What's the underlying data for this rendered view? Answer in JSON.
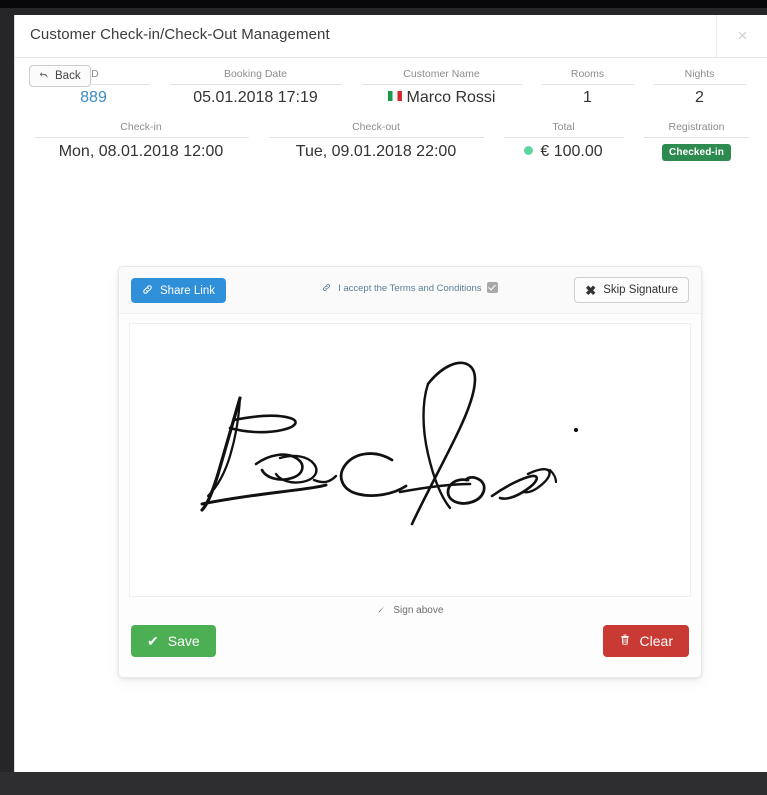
{
  "modal": {
    "title": "Customer Check-in/Check-Out Management",
    "close_label": "×"
  },
  "toolbar": {
    "back_label": "Back"
  },
  "booking": {
    "row1_headers": [
      "ID",
      "Booking Date",
      "Customer Name",
      "Rooms",
      "Nights"
    ],
    "row1_values": {
      "id": "889",
      "booking_date": "05.01.2018 17:19",
      "customer_name": "Marco Rossi",
      "customer_flag": "italy-flag",
      "rooms": "1",
      "nights": "2"
    },
    "row2_headers": [
      "Check-in",
      "Check-out",
      "Total",
      "Registration"
    ],
    "row2_values": {
      "check_in": "Mon, 08.01.2018 12:00",
      "check_out": "Tue, 09.01.2018 22:00",
      "total": "€ 100.00",
      "registration_badge": "Checked-in"
    }
  },
  "signature_card": {
    "share_link_label": "Share Link",
    "terms_label": "I accept the Terms and Conditions",
    "terms_checked": true,
    "skip_label": "Skip Signature",
    "sign_hint": "Sign above",
    "save_label": "Save",
    "clear_label": "Clear"
  },
  "colors": {
    "share_blue": "#2f8fd8",
    "save_green": "#4caf54",
    "clear_red": "#ca3a35",
    "badge_green": "#2e8b4f",
    "status_dot": "#5fd6a0",
    "id_link": "#3b8bc4"
  }
}
